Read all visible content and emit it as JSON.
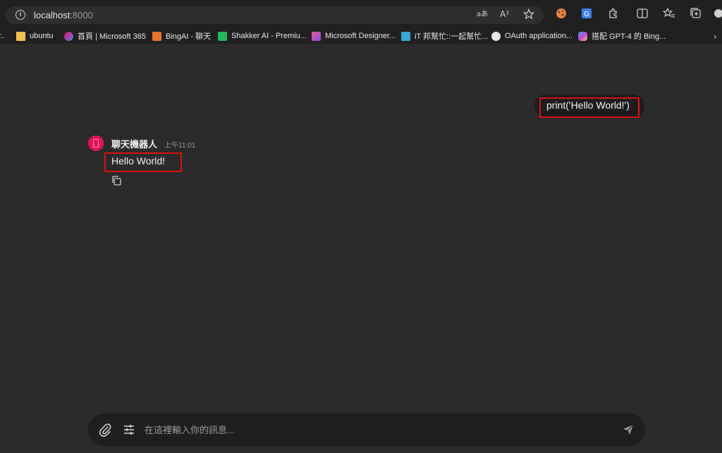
{
  "browser": {
    "url_host": "localhost",
    "url_port": ":8000",
    "read_aloud_icon": "read-aloud-icon",
    "translate_icon": "translate-icon"
  },
  "bookmarks": [
    {
      "label": "ubuntu",
      "icon": "folder-icon",
      "color": "#f2c14e"
    },
    {
      "label": "首頁 | Microsoft 365",
      "icon": "m365-icon",
      "color": "#5b7cf0"
    },
    {
      "label": "BingAI - 聊天",
      "icon": "bingai-icon",
      "color": "#e8762c"
    },
    {
      "label": "Shakker AI - Premiu...",
      "icon": "shakker-icon",
      "color": "#1fb65e"
    },
    {
      "label": "Microsoft Designer...",
      "icon": "designer-icon",
      "color": "#c248e0"
    },
    {
      "label": "iT 邦幫忙::一起幫忙...",
      "icon": "ithome-icon",
      "color": "#3aa7d8"
    },
    {
      "label": "OAuth application...",
      "icon": "github-icon",
      "color": "#e6e6e6"
    },
    {
      "label": "搭配 GPT-4 的 Bing...",
      "icon": "copilot-icon",
      "color": "#7e6cf0"
    }
  ],
  "chat": {
    "user_message": "print('Hello World!')",
    "bot": {
      "name": "聊天機器人",
      "time": "上午11:01",
      "message": "Hello World!",
      "avatar_color": "#e8105f"
    },
    "highlight_color": "#e01010"
  },
  "composer": {
    "placeholder": "在這裡輸入你的訊息...",
    "value": ""
  }
}
